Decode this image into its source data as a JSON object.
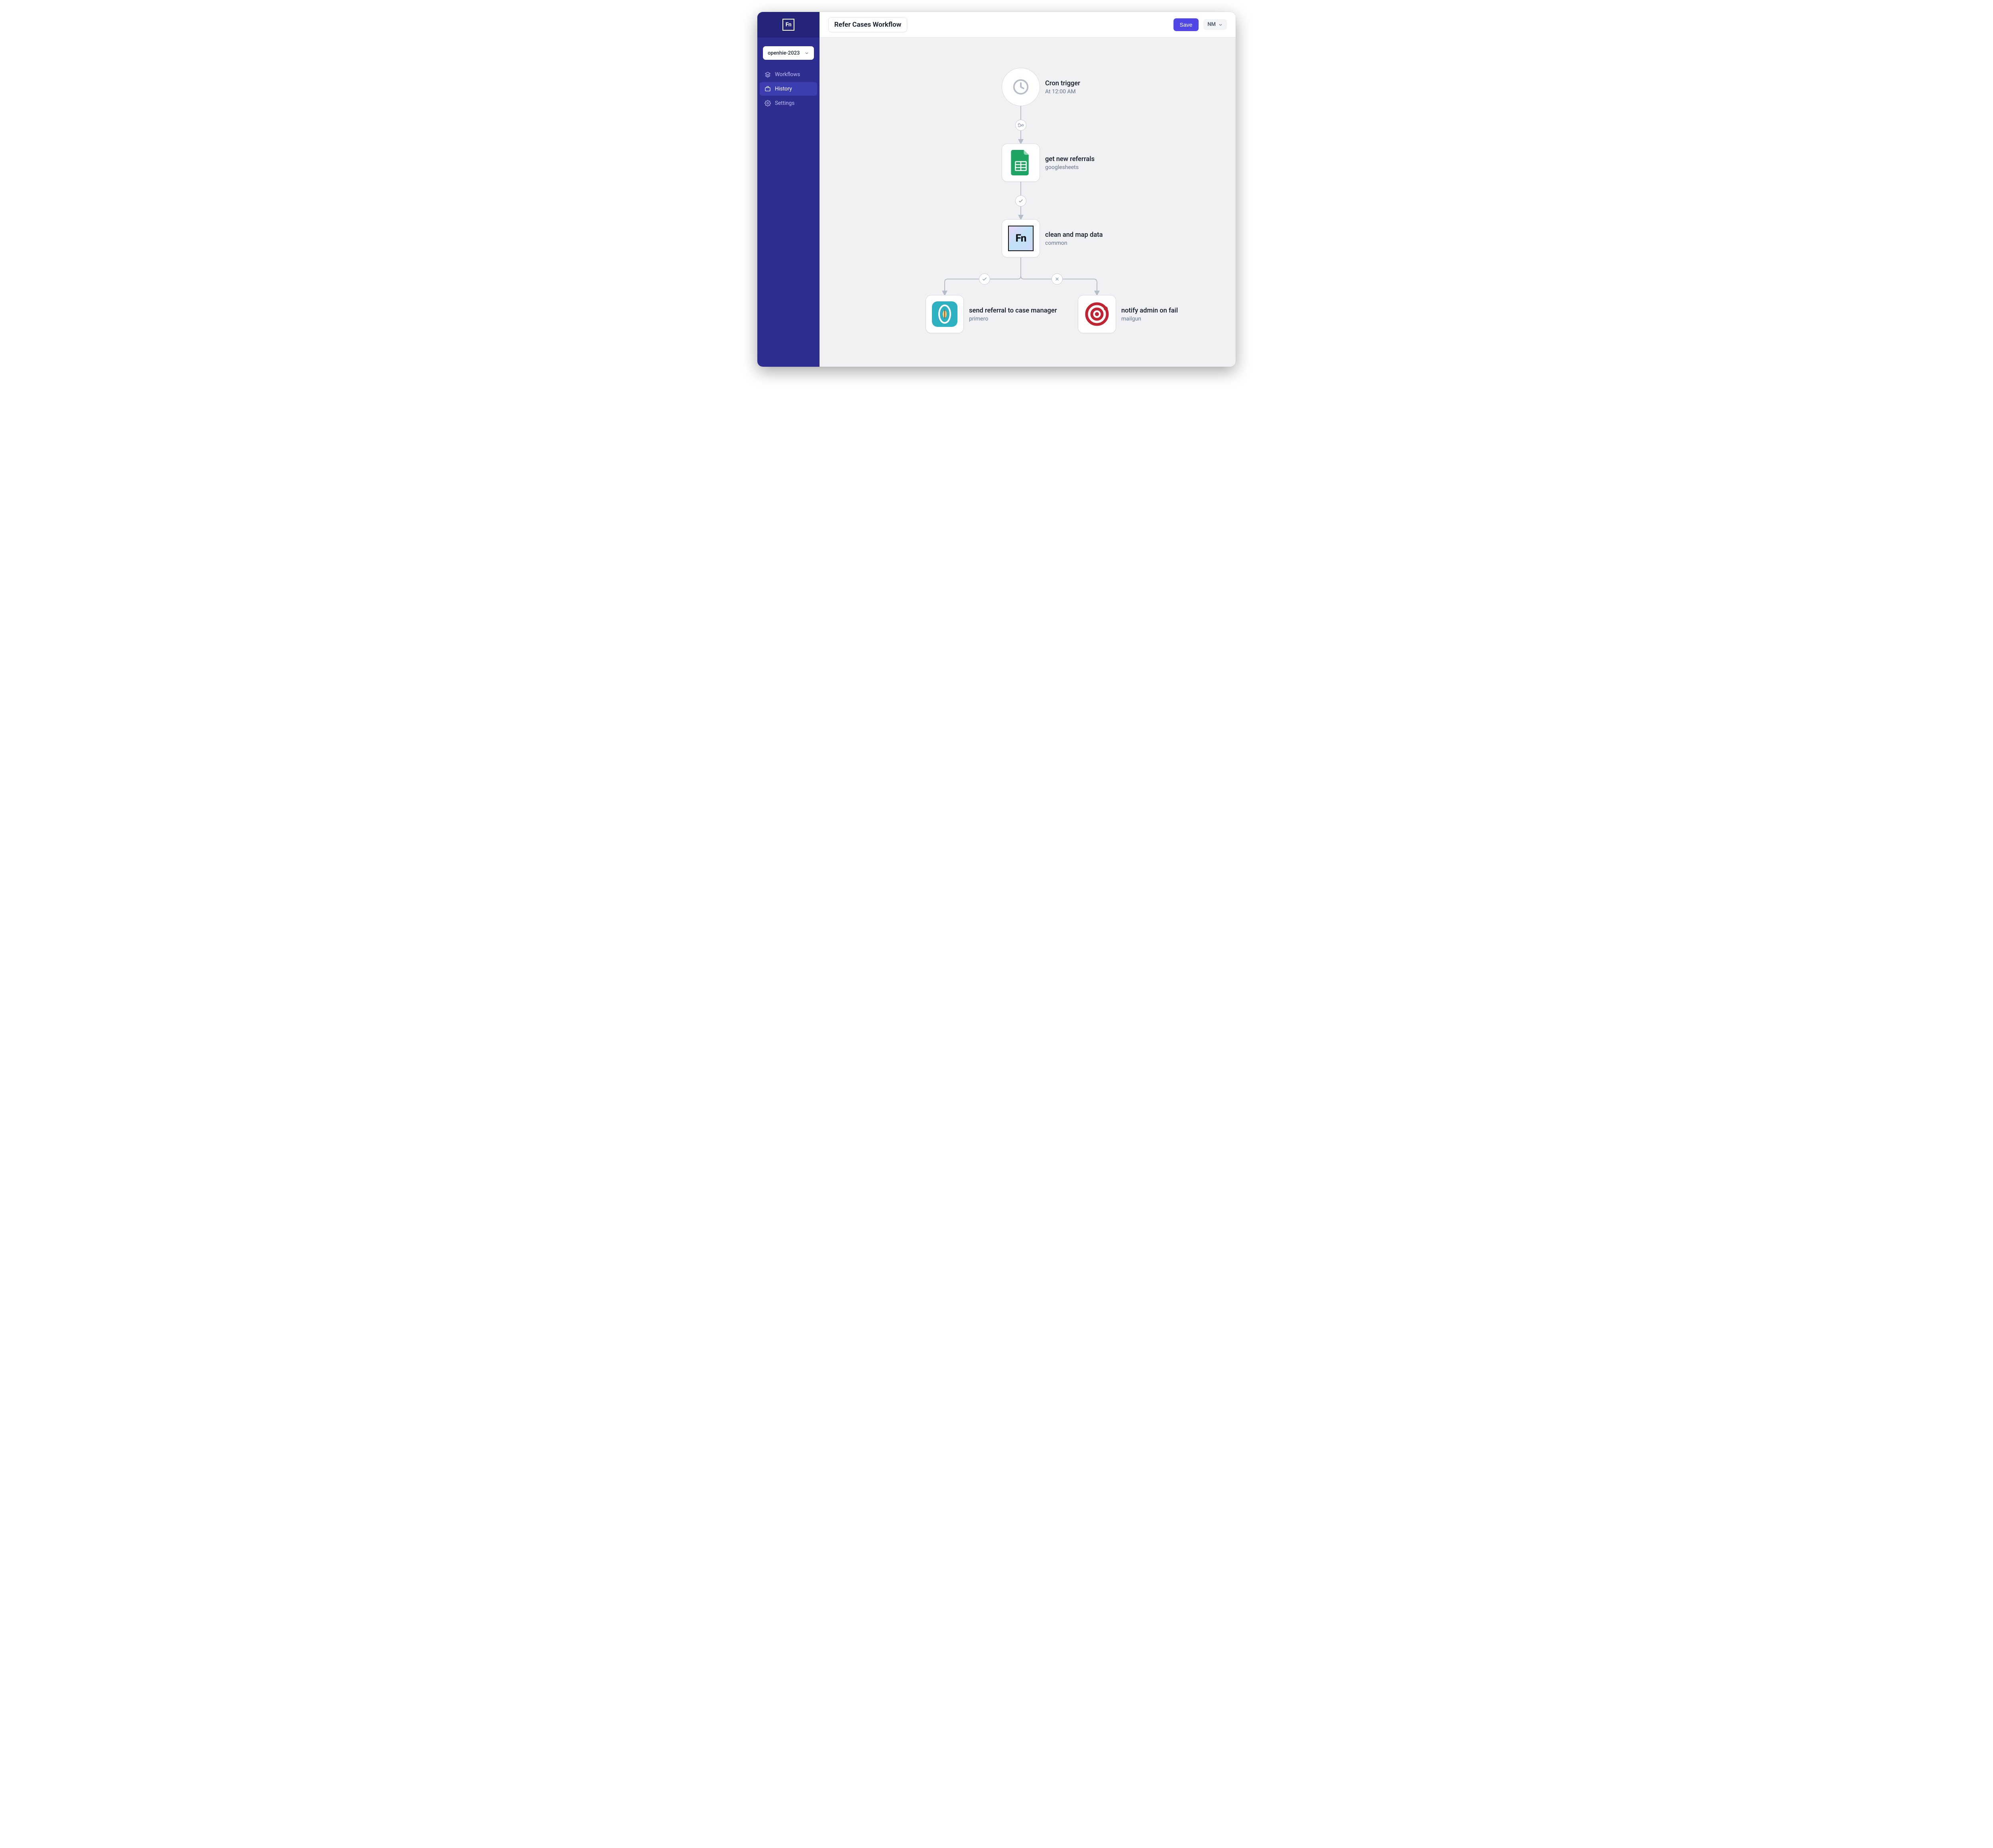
{
  "brand": {
    "logo_text": "Fn"
  },
  "project_picker": {
    "label": "openhie-2023"
  },
  "sidebar": {
    "items": [
      {
        "label": "Workflows",
        "icon": "layers-icon",
        "active": false
      },
      {
        "label": "History",
        "icon": "briefcase-icon",
        "active": true
      },
      {
        "label": "Settings",
        "icon": "gear-icon",
        "active": false
      }
    ]
  },
  "header": {
    "title": "Refer Cases Workflow",
    "save_label": "Save",
    "user_initials": "NM"
  },
  "flow": {
    "nodes": {
      "trigger": {
        "title": "Cron trigger",
        "subtitle": "At 12:00 AM"
      },
      "sheets": {
        "title": "get new referrals",
        "subtitle": "googlesheets"
      },
      "clean": {
        "title": "clean and map data",
        "subtitle": "common"
      },
      "primero": {
        "title": "send referral to case manager",
        "subtitle": "primero"
      },
      "mailgun": {
        "title": "notify admin on fail",
        "subtitle": "mailgun"
      }
    },
    "edge_types": {
      "trigger_to_sheets": "always",
      "sheets_to_clean": "success",
      "clean_to_primero": "success",
      "clean_to_mailgun": "failure"
    }
  }
}
